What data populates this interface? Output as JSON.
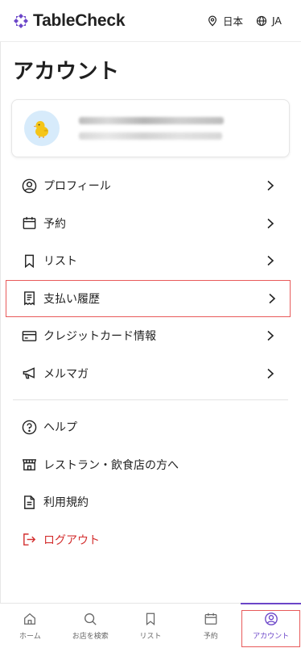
{
  "header": {
    "brand": "TableCheck",
    "region_label": "日本",
    "language_label": "JA",
    "brand_color": "#6b45c8"
  },
  "page": {
    "title": "アカウント"
  },
  "profile": {
    "avatar_icon": "chick-icon"
  },
  "menu": {
    "primary": [
      {
        "label": "プロフィール",
        "icon": "user-circle-icon"
      },
      {
        "label": "予約",
        "icon": "calendar-icon"
      },
      {
        "label": "リスト",
        "icon": "bookmark-icon"
      },
      {
        "label": "支払い履歴",
        "icon": "receipt-icon"
      },
      {
        "label": "クレジットカード情報",
        "icon": "credit-card-icon"
      },
      {
        "label": "メルマガ",
        "icon": "megaphone-icon"
      }
    ],
    "secondary": [
      {
        "label": "ヘルプ",
        "icon": "help-icon"
      },
      {
        "label": "レストラン・飲食店の方へ",
        "icon": "store-icon"
      },
      {
        "label": "利用規約",
        "icon": "document-icon"
      },
      {
        "label": "ログアウト",
        "icon": "logout-icon",
        "color": "#d32f2f"
      }
    ]
  },
  "tabbar": {
    "tabs": [
      {
        "label": "ホーム",
        "icon": "home-icon"
      },
      {
        "label": "お店を検索",
        "icon": "search-icon"
      },
      {
        "label": "リスト",
        "icon": "bookmark-icon"
      },
      {
        "label": "予約",
        "icon": "calendar-icon"
      },
      {
        "label": "アカウント",
        "icon": "account-icon",
        "active": true
      }
    ]
  }
}
